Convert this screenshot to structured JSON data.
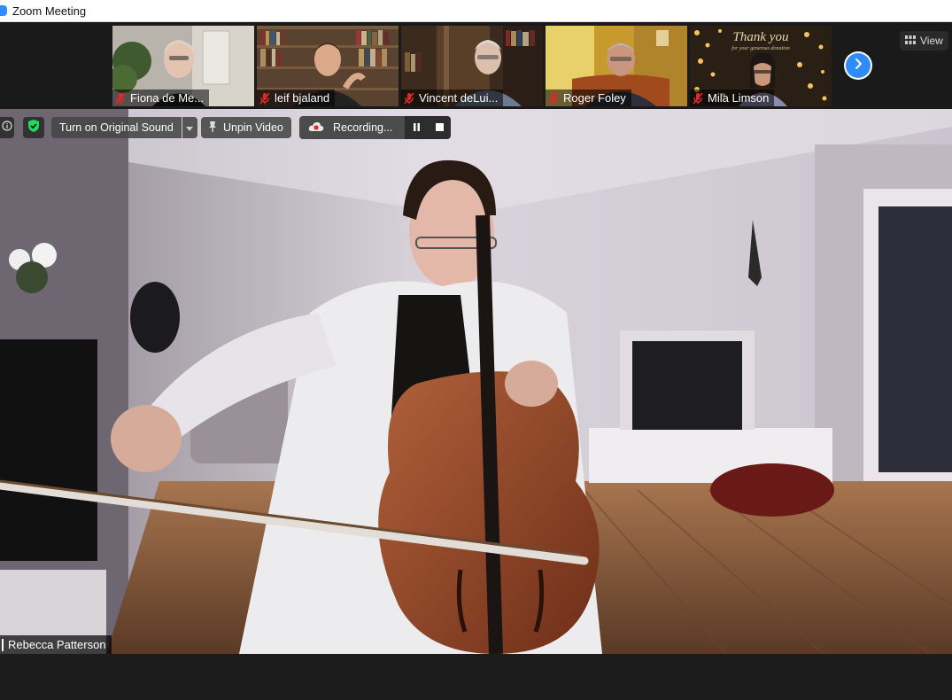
{
  "window": {
    "title": "Zoom Meeting"
  },
  "gallery": {
    "participants": [
      {
        "name": "Fiona de Me...",
        "muted": true
      },
      {
        "name": "leif bjaland",
        "muted": true
      },
      {
        "name": "Vincent deLui...",
        "muted": true
      },
      {
        "name": "Roger Foley",
        "muted": true
      },
      {
        "name": "Mila Limson",
        "muted": true
      }
    ],
    "thank_you_overlay": "Thank you",
    "thank_you_sub": "for your generous donation",
    "next_page_icon": "chevron-right-icon",
    "view_label": "View"
  },
  "main_video": {
    "speaker_name": "Rebecca Patterson",
    "controls": {
      "original_sound_label": "Turn on Original Sound",
      "unpin_label": "Unpin Video",
      "recording_label": "Recording..."
    }
  },
  "colors": {
    "accent": "#2d8cff",
    "muted_mic": "#e02828",
    "shield": "#23d959"
  }
}
